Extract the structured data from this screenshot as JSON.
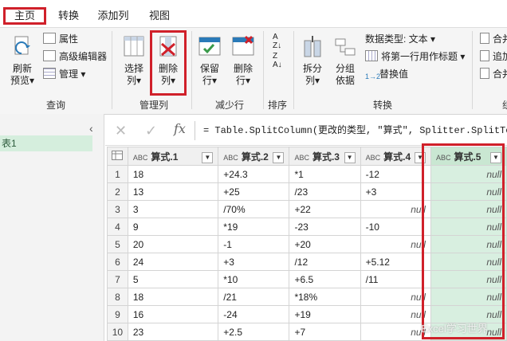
{
  "menu": {
    "tabs": [
      "主页",
      "转换",
      "添加列",
      "视图"
    ]
  },
  "ribbon": {
    "refresh": [
      "刷新",
      "预览"
    ],
    "properties": "属性",
    "advanced_editor": "高级编辑器",
    "manage": "管理",
    "choose_cols": [
      "选择",
      "列"
    ],
    "remove_cols": [
      "删除",
      "列"
    ],
    "keep_rows": [
      "保留",
      "行"
    ],
    "remove_rows": [
      "删除",
      "行"
    ],
    "split_col": [
      "拆分",
      "列"
    ],
    "group_by": [
      "分组",
      "依据"
    ],
    "data_type": "数据类型: 文本",
    "first_row_header": "将第一行用作标题",
    "replace_values": "替换值",
    "merge": "合并",
    "append": "追加",
    "combine": "合并",
    "groups": {
      "query": "查询",
      "manage_cols": "管理列",
      "reduce_rows": "减少行",
      "sort": "排序",
      "transform": "转换"
    },
    "truncated_group": "组"
  },
  "left_pane": {
    "query_item": "表1"
  },
  "formula_bar": {
    "text": "= Table.SplitColumn(更改的类型, \"算式\", Splitter.SplitTextB"
  },
  "table": {
    "type_icon": "ABC",
    "columns": [
      "算式.1",
      "算式.2",
      "算式.3",
      "算式.4",
      "算式.5"
    ],
    "rows": [
      [
        "18",
        "+24.3",
        "*1",
        "-12",
        "null"
      ],
      [
        "13",
        "+25",
        "/23",
        "+3",
        "null"
      ],
      [
        "3",
        "/70%",
        "+22",
        "null",
        "null"
      ],
      [
        "9",
        "*19",
        "-23",
        "-10",
        "null"
      ],
      [
        "20",
        "-1",
        "+20",
        "null",
        "null"
      ],
      [
        "24",
        "+3",
        "/12",
        "+5.12",
        "null"
      ],
      [
        "5",
        "*10",
        "+6.5",
        "/11",
        "null"
      ],
      [
        "18",
        "/21",
        "*18%",
        "null",
        "null"
      ],
      [
        "16",
        "-24",
        "+19",
        "null",
        "null"
      ],
      [
        "23",
        "+2.5",
        "+7",
        "null",
        "null"
      ]
    ]
  },
  "watermark": "Excel学习世界",
  "colors": {
    "accent_red": "#d0202a",
    "selected_col": "#d8efe0"
  }
}
